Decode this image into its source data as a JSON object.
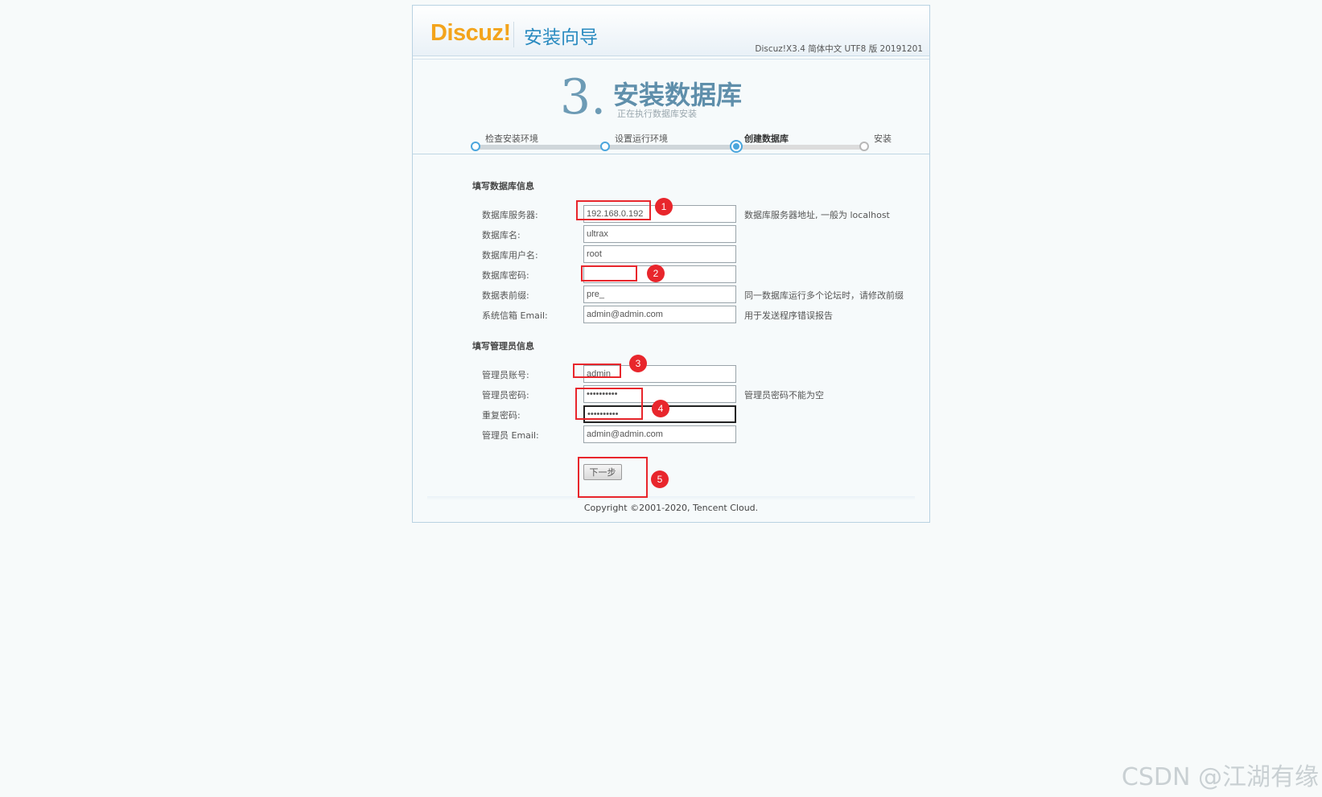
{
  "header": {
    "logo": "Discuz!",
    "wizard_title": "安装向导",
    "version": "Discuz!X3.4 简体中文 UTF8 版 20191201"
  },
  "step": {
    "number": "3.",
    "title": "安装数据库",
    "subtitle": "正在执行数据库安装"
  },
  "progress": {
    "steps": [
      "检查安装环境",
      "设置运行环境",
      "创建数据库",
      "安装"
    ],
    "current_index": 2
  },
  "db_section": {
    "title": "填写数据库信息",
    "fields": [
      {
        "label": "数据库服务器:",
        "value": "192.168.0.192",
        "hint": "数据库服务器地址, 一般为 localhost"
      },
      {
        "label": "数据库名:",
        "value": "ultrax",
        "hint": ""
      },
      {
        "label": "数据库用户名:",
        "value": "root",
        "hint": ""
      },
      {
        "label": "数据库密码:",
        "value": "",
        "hint": ""
      },
      {
        "label": "数据表前缀:",
        "value": "pre_",
        "hint": "同一数据库运行多个论坛时，请修改前缀"
      },
      {
        "label": "系统信箱 Email:",
        "value": "admin@admin.com",
        "hint": "用于发送程序错误报告"
      }
    ]
  },
  "admin_section": {
    "title": "填写管理员信息",
    "fields": [
      {
        "label": "管理员账号:",
        "value": "admin",
        "hint": ""
      },
      {
        "label": "管理员密码:",
        "value": "••••••••••",
        "hint": "管理员密码不能为空"
      },
      {
        "label": "重复密码:",
        "value": "••••••••••",
        "hint": ""
      },
      {
        "label": "管理员 Email:",
        "value": "admin@admin.com",
        "hint": ""
      }
    ]
  },
  "next_button": "下一步",
  "copyright": "Copyright ©2001-2020, Tencent Cloud.",
  "annotations": [
    "1",
    "2",
    "3",
    "4",
    "5"
  ],
  "watermark": "CSDN @江湖有缘",
  "colors": {
    "accent": "#2a8bc0",
    "logo": "#f3a41c",
    "annotation": "#e8262c"
  }
}
